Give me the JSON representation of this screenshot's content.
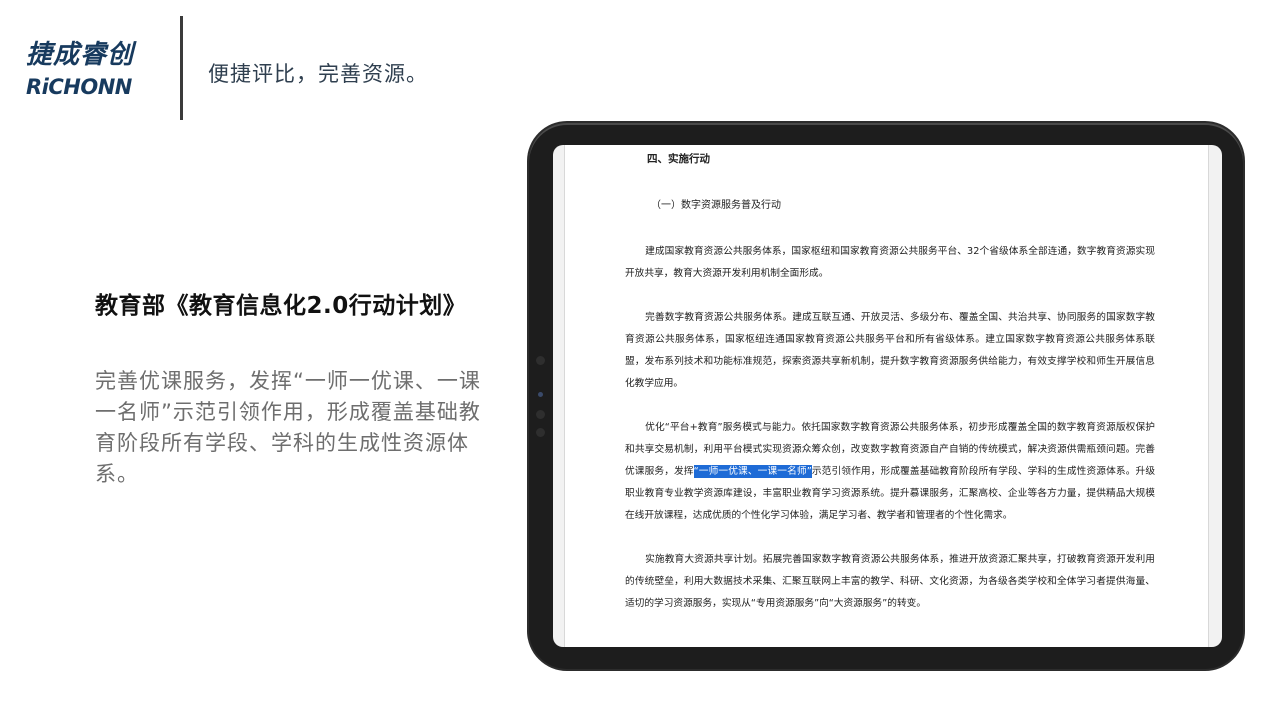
{
  "brand": {
    "name_cn": "捷成睿创",
    "name_en": "RiCHONN"
  },
  "header": {
    "slogan": "便捷评比，完善资源。"
  },
  "left": {
    "title": "教育部《教育信息化2.0行动计划》",
    "description": "完善优课服务，发挥“一师一优课、一课一名师”示范引领作用，形成覆盖基础教育阶段所有学段、学科的生成性资源体系。"
  },
  "document": {
    "heading": "四、实施行动",
    "subheading": "（一）数字资源服务普及行动",
    "para1": "建成国家教育资源公共服务体系，国家枢纽和国家教育资源公共服务平台、32个省级体系全部连通，数字教育资源实现开放共享，教育大资源开发利用机制全面形成。",
    "para2": "完善数字教育资源公共服务体系。建成互联互通、开放灵活、多级分布、覆盖全国、共治共享、协同服务的国家数字教育资源公共服务体系，国家枢纽连通国家教育资源公共服务平台和所有省级体系。建立国家数字教育资源公共服务体系联盟，发布系列技术和功能标准规范，探索资源共享新机制，提升数字教育资源服务供给能力，有效支撑学校和师生开展信息化教学应用。",
    "para3_before": "优化“平台+教育”服务模式与能力。依托国家数字教育资源公共服务体系，初步形成覆盖全国的数字教育资源版权保护和共享交易机制，利用平台模式实现资源众筹众创，改变数字教育资源自产自销的传统模式，解决资源供需瓶颈问题。完善优课服务，发挥",
    "para3_highlight": "“一师一优课、一课一名师”",
    "para3_after": "示范引领作用，形成覆盖基础教育阶段所有学段、学科的生成性资源体系。升级职业教育专业教学资源库建设，丰富职业教育学习资源系统。提升慕课服务，汇聚高校、企业等各方力量，提供精品大规模在线开放课程，达成优质的个性化学习体验，满足学习者、教学者和管理者的个性化需求。",
    "para4": "实施教育大资源共享计划。拓展完善国家数字教育资源公共服务体系，推进开放资源汇聚共享，打破教育资源开发利用的传统壁垒，利用大数据技术采集、汇聚互联网上丰富的教学、科研、文化资源，为各级各类学校和全体学习者提供海量、适切的学习资源服务，实现从“专用资源服务”向“大资源服务”的转变。"
  },
  "colors": {
    "brand": "#173a5e",
    "highlight": "#1e6bd6",
    "tablet_frame": "#1d1d1d"
  }
}
